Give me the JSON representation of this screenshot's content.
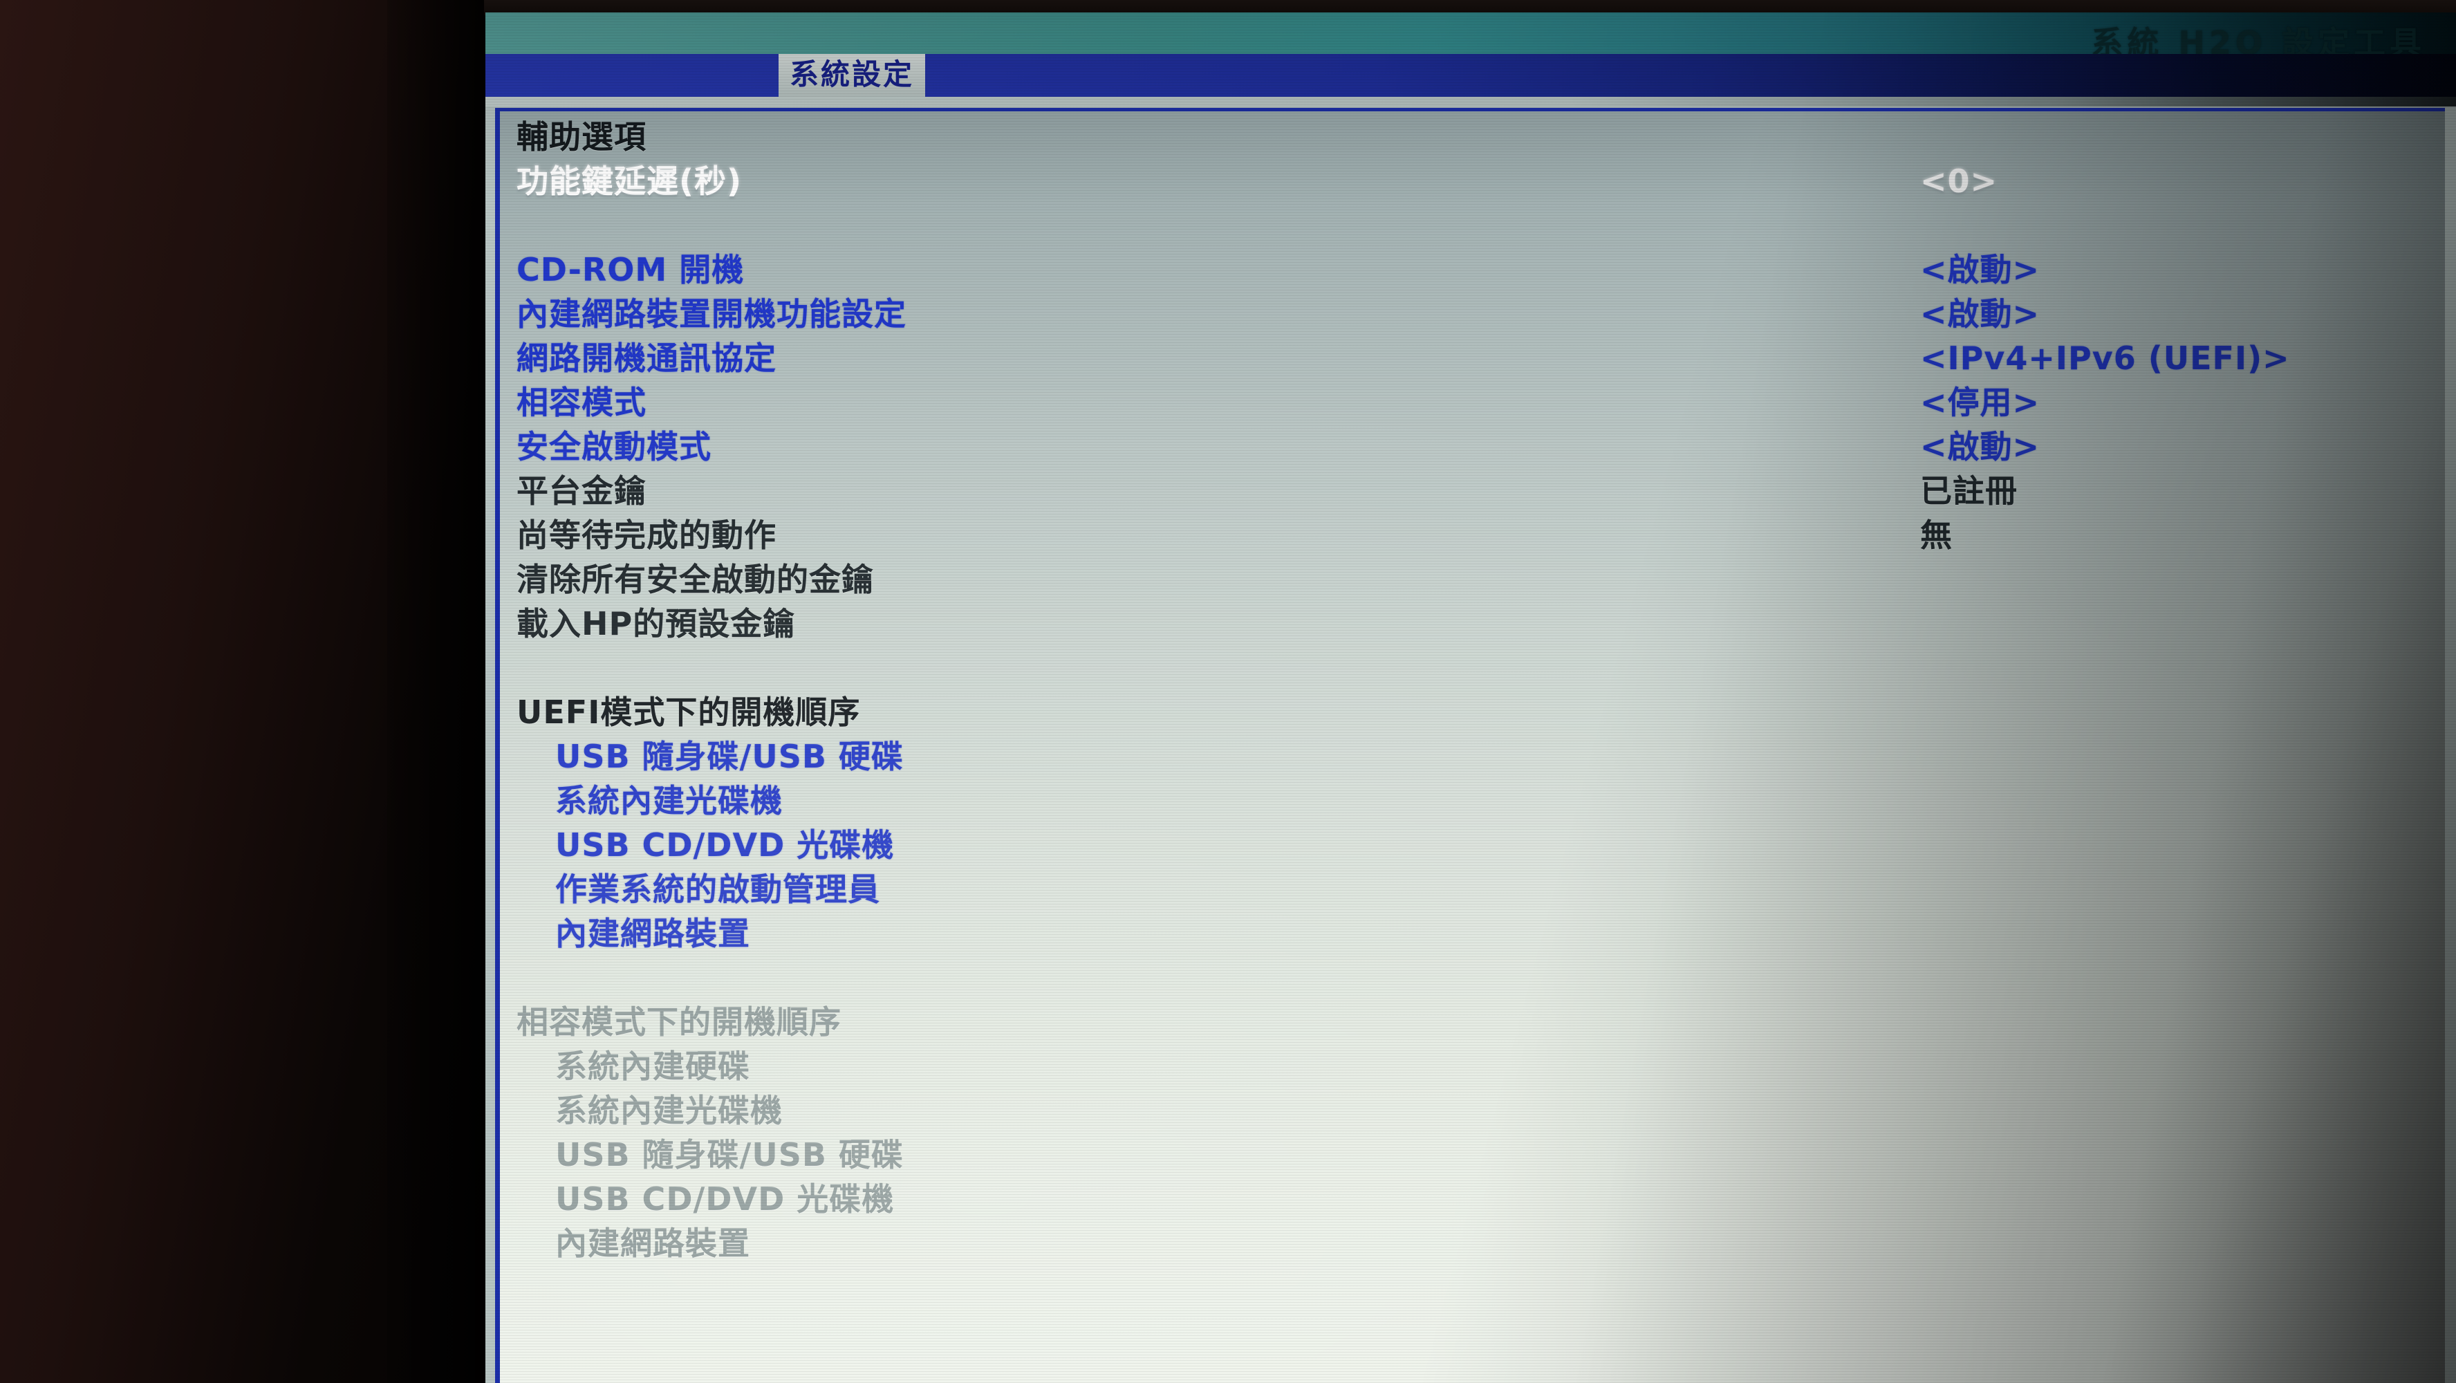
{
  "window": {
    "title": "系統 H2O 設定工具",
    "tab_active": "系統設定"
  },
  "panel": {
    "rows": [
      {
        "label": "輔助選項",
        "value": "",
        "label_style": "t-header",
        "value_style": "",
        "indent": 0,
        "interactable": false
      },
      {
        "label": "功能鍵延遲(秒)",
        "value": "<0>",
        "label_style": "t-selected",
        "value_style": "t-selected",
        "indent": 0,
        "interactable": true
      },
      {
        "label": "",
        "value": "",
        "label_style": "",
        "value_style": "",
        "indent": 0,
        "interactable": false
      },
      {
        "label": "CD-ROM 開機",
        "value": "<啟動>",
        "label_style": "t-link",
        "value_style": "t-link",
        "indent": 0,
        "interactable": true
      },
      {
        "label": "內建網路裝置開機功能設定",
        "value": "<啟動>",
        "label_style": "t-link",
        "value_style": "t-link",
        "indent": 0,
        "interactable": true
      },
      {
        "label": "網路開機通訊協定",
        "value": "<IPv4+IPv6 (UEFI)>",
        "label_style": "t-link",
        "value_style": "t-link",
        "indent": 0,
        "interactable": true
      },
      {
        "label": "相容模式",
        "value": "<停用>",
        "label_style": "t-link",
        "value_style": "t-link",
        "indent": 0,
        "interactable": true
      },
      {
        "label": "安全啟動模式",
        "value": "<啟動>",
        "label_style": "t-link",
        "value_style": "t-link",
        "indent": 0,
        "interactable": true
      },
      {
        "label": "平台金鑰",
        "value": "已註冊",
        "label_style": "t-static",
        "value_style": "t-static",
        "indent": 0,
        "interactable": false
      },
      {
        "label": "尚等待完成的動作",
        "value": "無",
        "label_style": "t-static",
        "value_style": "t-static",
        "indent": 0,
        "interactable": false
      },
      {
        "label": "清除所有安全啟動的金鑰",
        "value": "",
        "label_style": "t-static",
        "value_style": "",
        "indent": 0,
        "interactable": true
      },
      {
        "label": "載入HP的預設金鑰",
        "value": "",
        "label_style": "t-static",
        "value_style": "",
        "indent": 0,
        "interactable": true
      },
      {
        "label": "",
        "value": "",
        "label_style": "",
        "value_style": "",
        "indent": 0,
        "interactable": false
      },
      {
        "label": "UEFI模式下的開機順序",
        "value": "",
        "label_style": "t-header",
        "value_style": "",
        "indent": 0,
        "interactable": false
      },
      {
        "label": "USB 隨身碟/USB 硬碟",
        "value": "",
        "label_style": "t-link",
        "value_style": "",
        "indent": 1,
        "interactable": true
      },
      {
        "label": "系統內建光碟機",
        "value": "",
        "label_style": "t-link",
        "value_style": "",
        "indent": 1,
        "interactable": true
      },
      {
        "label": "USB CD/DVD 光碟機",
        "value": "",
        "label_style": "t-link",
        "value_style": "",
        "indent": 1,
        "interactable": true
      },
      {
        "label": "作業系統的啟動管理員",
        "value": "",
        "label_style": "t-link",
        "value_style": "",
        "indent": 1,
        "interactable": true
      },
      {
        "label": "內建網路裝置",
        "value": "",
        "label_style": "t-link",
        "value_style": "",
        "indent": 1,
        "interactable": true
      },
      {
        "label": "",
        "value": "",
        "label_style": "",
        "value_style": "",
        "indent": 0,
        "interactable": false
      },
      {
        "label": "相容模式下的開機順序",
        "value": "",
        "label_style": "t-disabled",
        "value_style": "",
        "indent": 0,
        "interactable": false
      },
      {
        "label": "系統內建硬碟",
        "value": "",
        "label_style": "t-disabled",
        "value_style": "",
        "indent": 1,
        "interactable": false
      },
      {
        "label": "系統內建光碟機",
        "value": "",
        "label_style": "t-disabled",
        "value_style": "",
        "indent": 1,
        "interactable": false
      },
      {
        "label": "USB 隨身碟/USB 硬碟",
        "value": "",
        "label_style": "t-disabled",
        "value_style": "",
        "indent": 1,
        "interactable": false
      },
      {
        "label": "USB CD/DVD 光碟機",
        "value": "",
        "label_style": "t-disabled",
        "value_style": "",
        "indent": 1,
        "interactable": false
      },
      {
        "label": "內建網路裝置",
        "value": "",
        "label_style": "t-disabled",
        "value_style": "",
        "indent": 1,
        "interactable": false
      }
    ]
  },
  "colors": {
    "accent_blue": "#2137c7",
    "tabbar_blue": "#2738b0",
    "banner_teal": "#3f9490",
    "selected_white": "#ffffff",
    "disabled_grey": "#8d9a99"
  }
}
